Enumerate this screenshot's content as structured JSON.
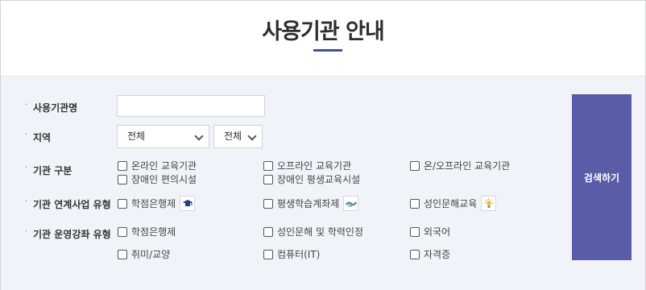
{
  "page": {
    "title": "사용기관 안내"
  },
  "form": {
    "org_name": {
      "label": "사용기관명",
      "value": "",
      "placeholder": ""
    },
    "region": {
      "label": "지역",
      "select1": "전체",
      "select2": "전체"
    },
    "org_type": {
      "label": "기관 구분",
      "options": [
        "온라인 교육기관",
        "오프라인 교육기관",
        "온/오프라인 교육기관",
        "장애인 편의시설",
        "장애인 평생교육시설"
      ]
    },
    "linked_program": {
      "label": "기관 연계사업 유형",
      "options": [
        {
          "text": "학점은행제",
          "icon": "graduation-cap-icon"
        },
        {
          "text": "평생학습계좌제",
          "icon": "handshake-icon"
        },
        {
          "text": "성인문해교육",
          "icon": "lightbulb-icon"
        }
      ]
    },
    "course_type": {
      "label": "기관 운영강좌 유형",
      "options": [
        "학점은행제",
        "성인문해 및 학력인정",
        "외국어",
        "취미/교양",
        "컴퓨터(IT)",
        "자격증"
      ]
    },
    "search_button": "검색하기"
  },
  "colors": {
    "accent": "#5b5ca8",
    "panel_bg": "#f2f3f8",
    "title_bar": "#4c4f8f"
  }
}
